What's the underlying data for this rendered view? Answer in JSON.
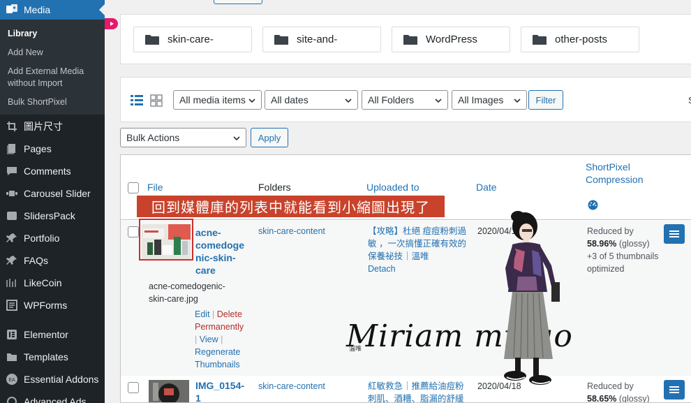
{
  "sidebar": {
    "media_label": "Media",
    "submenu": [
      {
        "label": "Library"
      },
      {
        "label": "Add New"
      },
      {
        "label": "Add External Media\nwithout Import"
      },
      {
        "label": "Bulk ShortPixel"
      }
    ],
    "items": [
      {
        "label": "圖片尺寸",
        "icon": "crop-icon"
      },
      {
        "label": "Pages",
        "icon": "pages-icon"
      },
      {
        "label": "Comments",
        "icon": "comments-icon"
      },
      {
        "label": "Carousel Slider",
        "icon": "slider-icon"
      },
      {
        "label": "SlidersPack",
        "icon": "sliderspack-icon"
      },
      {
        "label": "Portfolio",
        "icon": "pin-icon"
      },
      {
        "label": "FAQs",
        "icon": "pin-icon"
      },
      {
        "label": "LikeCoin",
        "icon": "likecoin-icon"
      },
      {
        "label": "WPForms",
        "icon": "forms-icon"
      },
      {
        "label": "Elementor",
        "icon": "elementor-icon"
      },
      {
        "label": "Templates",
        "icon": "folder-icon"
      },
      {
        "label": "Essential Addons",
        "icon": "ea-icon"
      },
      {
        "label": "Advanced Ads",
        "icon": "ads-icon"
      }
    ]
  },
  "folders": [
    {
      "label": "skin-care-"
    },
    {
      "label": "site-and-"
    },
    {
      "label": "WordPress"
    },
    {
      "label": "other-posts"
    }
  ],
  "toolbar": {
    "filters": [
      {
        "value": "All media items"
      },
      {
        "value": "All dates"
      },
      {
        "value": "All Folders"
      },
      {
        "value": "All Images"
      }
    ],
    "filter_button": "Filter",
    "cut_text": "S"
  },
  "bulk": {
    "select_value": "Bulk Actions",
    "apply_button": "Apply"
  },
  "table": {
    "headers": {
      "file": "File",
      "folders": "Folders",
      "uploaded_to": "Uploaded to",
      "date": "Date",
      "shortpixel_1": "ShortPixel",
      "shortpixel_2": "Compression"
    },
    "rows": [
      {
        "title_lines": [
          "acne-",
          "comedoge",
          "nic-skin-",
          "care"
        ],
        "filename_lines": [
          "acne-comedogenic-",
          "skin-care.jpg"
        ],
        "actions": {
          "edit": "Edit",
          "delete_1": "Delete",
          "delete_2": "Permanently",
          "view": "View",
          "regen_1": "Regenerate",
          "regen_2": "Thumbnails"
        },
        "folder": "skin-care-content",
        "uploaded_lines": [
          "【攻略】杜絕 痘痘粉刺過",
          "敏 ，一次搞懂正確有效的",
          "保養祕技｜溫唯"
        ],
        "detach": "Detach",
        "date": "2020/04/1",
        "sp_line1": "Reduced by",
        "sp_pct": "58.96%",
        "sp_type": " (glossy)",
        "sp_line3": "+3 of 5 thumbnails",
        "sp_line4": "optimized"
      },
      {
        "title_lines": [
          "IMG_0154-",
          "1"
        ],
        "folder": "skin-care-content",
        "uploaded_lines": [
          "紅敏救急｜推薦給油痘粉",
          "刺肌、酒糟、脂漏的舒緩"
        ],
        "date": "2020/04/18",
        "sp_line1": "Reduced by",
        "sp_pct": "58.65%",
        "sp_type": " (glossy)"
      }
    ]
  },
  "overlay": {
    "banner": "回到媒體庫的列表中就能看到小縮圖出現了",
    "signature": "Miriam mibao",
    "signature_small": "溫唯"
  },
  "colors": {
    "sidebar_bg": "#1d2327",
    "accent": "#2271b1",
    "banner": "#c9432c",
    "delete": "#b32d2e"
  }
}
